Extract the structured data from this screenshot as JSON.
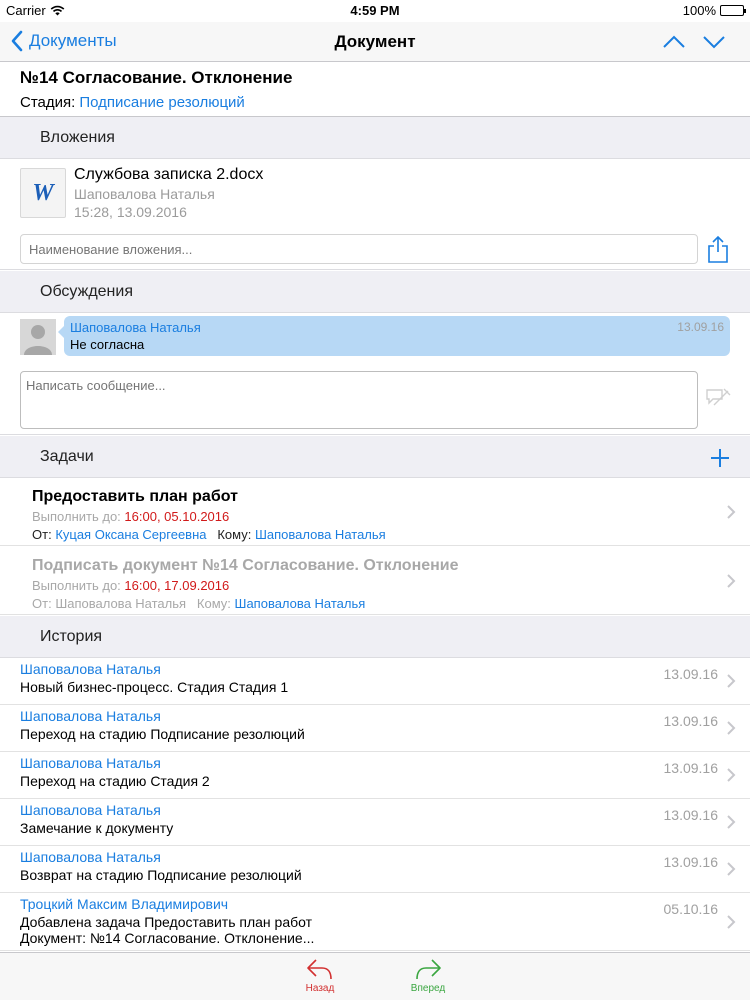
{
  "status": {
    "carrier": "Carrier",
    "time": "4:59 PM",
    "battery": "100%"
  },
  "nav": {
    "back_label": "Документы",
    "title": "Документ"
  },
  "document": {
    "title": "№14 Согласование. Отклонение",
    "stage_label": "Стадия:",
    "stage_value": "Подписание резолюций"
  },
  "attachments": {
    "header": "Вложения",
    "file": {
      "name": "Службова записка 2.docx",
      "author": "Шаповалова Наталья",
      "date": "15:28, 13.09.2016",
      "icon_letter": "W"
    },
    "input_placeholder": "Наименование вложения..."
  },
  "discussions": {
    "header": "Обсуждения",
    "message": {
      "author": "Шаповалова Наталья",
      "text": "Не согласна",
      "date": "13.09.16"
    },
    "input_placeholder": "Написать сообщение..."
  },
  "tasks": {
    "header": "Задачи",
    "due_label": "Выполнить до:",
    "from_label": "От:",
    "to_label": "Кому:",
    "items": [
      {
        "title": "Предоставить план работ",
        "due": "16:00, 05.10.2016",
        "from": "Куцая Оксана Сергеевна",
        "to": "Шаповалова Наталья"
      },
      {
        "title": "Подписать документ №14 Согласование. Отклонение",
        "due": "16:00, 17.09.2016",
        "from": "Шаповалова Наталья",
        "to": "Шаповалова Наталья"
      }
    ]
  },
  "history": {
    "header": "История",
    "items": [
      {
        "author": "Шаповалова Наталья",
        "text": "Новый бизнес-процесс. Стадия Стадия 1",
        "date": "13.09.16"
      },
      {
        "author": "Шаповалова Наталья",
        "text": "Переход на стадию Подписание резолюций",
        "date": "13.09.16"
      },
      {
        "author": "Шаповалова Наталья",
        "text": "Переход на стадию Стадия 2",
        "date": "13.09.16"
      },
      {
        "author": "Шаповалова Наталья",
        "text": "Замечание к документу",
        "date": "13.09.16"
      },
      {
        "author": "Шаповалова Наталья",
        "text": "Возврат на стадию Подписание резолюций",
        "date": "13.09.16"
      },
      {
        "author": "Троцкий Максим Владимирович",
        "text": "Добавлена задача Предоставить план работ",
        "text2": "Документ: №14 Согласование. Отклонение...",
        "date": "05.10.16"
      }
    ]
  },
  "tabbar": {
    "back_label": "Назад",
    "forward_label": "Вперед"
  },
  "colors": {
    "accent": "#1a7ee0",
    "due": "#d11a1a",
    "back": "#d23030",
    "forward": "#3aa640",
    "bubble": "#b7d8f5"
  }
}
